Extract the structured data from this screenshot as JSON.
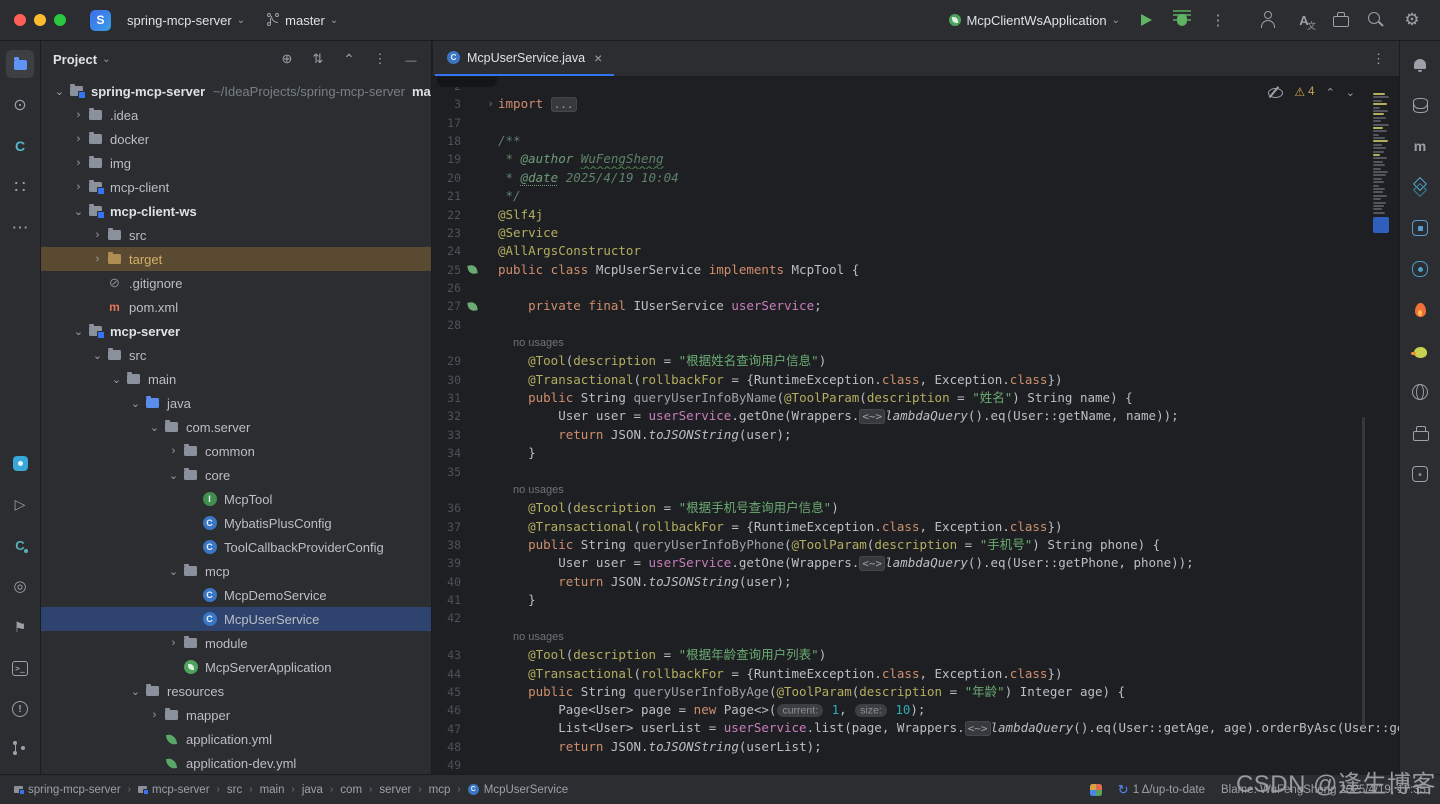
{
  "colors": {
    "accent": "#3574f0",
    "selection": "#2e436e",
    "modified_row": "#5a4a32",
    "warning": "#d9a343",
    "editor_bg": "#1e1f22",
    "panel_bg": "#2b2d30"
  },
  "titlebar": {
    "logo_letter": "S",
    "project_name": "spring-mcp-server",
    "branch_name": "master",
    "run_config": "McpClientWsApplication",
    "actions": [
      "run",
      "debug",
      "more-actions"
    ],
    "tools": [
      "add-user",
      "translate",
      "toolbox",
      "search",
      "settings"
    ]
  },
  "left_toolbar": {
    "top": [
      "project",
      "commit",
      "codegeex",
      "services",
      "more"
    ],
    "bottom": [
      "plugin",
      "run",
      "codegeex-chat",
      "coverage",
      "bookmarks",
      "terminal",
      "problems",
      "version-control"
    ]
  },
  "right_toolbar": [
    "notifications",
    "database",
    "maven",
    "dependencies",
    "plugin-a",
    "plugin-b",
    "hot-reload",
    "duck",
    "translation",
    "printer",
    "ai-assistant"
  ],
  "project_panel": {
    "title": "Project",
    "header_icons": [
      "locate-file",
      "expand-all",
      "collapse-all",
      "more-options",
      "hide-panel"
    ],
    "tree": [
      {
        "label": "spring-mcp-server",
        "suffix": "~/IdeaProjects/spring-mcp-server",
        "branch": "master",
        "level": 0,
        "chevron": "open",
        "icon": "module",
        "bold": true
      },
      {
        "label": ".idea",
        "level": 1,
        "chevron": "closed",
        "icon": "folder"
      },
      {
        "label": "docker",
        "level": 1,
        "chevron": "closed",
        "icon": "folder"
      },
      {
        "label": "img",
        "level": 1,
        "chevron": "closed",
        "icon": "folder"
      },
      {
        "label": "mcp-client",
        "level": 1,
        "chevron": "closed",
        "icon": "module"
      },
      {
        "label": "mcp-client-ws",
        "level": 1,
        "chevron": "open",
        "icon": "module",
        "bold": true
      },
      {
        "label": "src",
        "level": 2,
        "chevron": "closed",
        "icon": "folder"
      },
      {
        "label": "target",
        "level": 2,
        "chevron": "closed",
        "icon": "folder-excluded",
        "state": "modified"
      },
      {
        "label": ".gitignore",
        "level": 2,
        "chevron": "none",
        "icon": "ignored"
      },
      {
        "label": "pom.xml",
        "level": 2,
        "chevron": "none",
        "icon": "maven"
      },
      {
        "label": "mcp-server",
        "level": 1,
        "chevron": "open",
        "icon": "module",
        "bold": true
      },
      {
        "label": "src",
        "level": 2,
        "chevron": "open",
        "icon": "folder"
      },
      {
        "label": "main",
        "level": 3,
        "chevron": "open",
        "icon": "folder"
      },
      {
        "label": "java",
        "level": 4,
        "chevron": "open",
        "icon": "folder-java"
      },
      {
        "label": "com.server",
        "level": 5,
        "chevron": "open",
        "icon": "folder"
      },
      {
        "label": "common",
        "level": 6,
        "chevron": "closed",
        "icon": "folder"
      },
      {
        "label": "core",
        "level": 6,
        "chevron": "open",
        "icon": "folder"
      },
      {
        "label": "McpTool",
        "level": 7,
        "chevron": "none",
        "icon": "interface"
      },
      {
        "label": "MybatisPlusConfig",
        "level": 7,
        "chevron": "none",
        "icon": "class"
      },
      {
        "label": "ToolCallbackProviderConfig",
        "level": 7,
        "chevron": "none",
        "icon": "class"
      },
      {
        "label": "mcp",
        "level": 6,
        "chevron": "open",
        "icon": "folder"
      },
      {
        "label": "McpDemoService",
        "level": 7,
        "chevron": "none",
        "icon": "class"
      },
      {
        "label": "McpUserService",
        "level": 7,
        "chevron": "none",
        "icon": "class",
        "state": "selected"
      },
      {
        "label": "module",
        "level": 6,
        "chevron": "closed",
        "icon": "folder"
      },
      {
        "label": "McpServerApplication",
        "level": 6,
        "chevron": "none",
        "icon": "spring-boot"
      },
      {
        "label": "resources",
        "level": 4,
        "chevron": "open",
        "icon": "folder"
      },
      {
        "label": "mapper",
        "level": 5,
        "chevron": "closed",
        "icon": "folder"
      },
      {
        "label": "application.yml",
        "level": 5,
        "chevron": "none",
        "icon": "leaf"
      },
      {
        "label": "application-dev.yml",
        "level": 5,
        "chevron": "none",
        "icon": "leaf"
      }
    ]
  },
  "editor": {
    "tab": {
      "label": "McpUserService.java"
    },
    "inspections": {
      "warning_count": "4"
    },
    "code": [
      {
        "n": "2",
        "segs": []
      },
      {
        "n": "3",
        "fold": "closed",
        "segs": [
          {
            "t": "import ",
            "c": "k"
          },
          {
            "t": "...",
            "c": "fold"
          }
        ]
      },
      {
        "n": "17",
        "segs": []
      },
      {
        "n": "18",
        "segs": [
          {
            "t": "/**",
            "c": "d"
          }
        ]
      },
      {
        "n": "19",
        "segs": [
          {
            "t": " * ",
            "c": "d"
          },
          {
            "t": "@author",
            "c": "dt"
          },
          {
            "t": " ",
            "c": "d"
          },
          {
            "t": "WuFengSheng",
            "c": "dsp"
          }
        ]
      },
      {
        "n": "20",
        "segs": [
          {
            "t": " * ",
            "c": "d"
          },
          {
            "t": "@date",
            "c": "dtsp"
          },
          {
            "t": " 2025/4/19 10:04",
            "c": "d"
          }
        ]
      },
      {
        "n": "21",
        "segs": [
          {
            "t": " */",
            "c": "d"
          }
        ]
      },
      {
        "n": "22",
        "segs": [
          {
            "t": "@Slf4j",
            "c": "a"
          }
        ]
      },
      {
        "n": "23",
        "segs": [
          {
            "t": "@Service",
            "c": "a"
          }
        ]
      },
      {
        "n": "24",
        "segs": [
          {
            "t": "@AllArgsConstructor",
            "c": "a"
          }
        ]
      },
      {
        "n": "25",
        "gutter": "bean",
        "segs": [
          {
            "t": "public class ",
            "c": "k"
          },
          {
            "t": "McpUserService ",
            "c": "p"
          },
          {
            "t": "implements ",
            "c": "k"
          },
          {
            "t": "McpTool {",
            "c": "p"
          }
        ]
      },
      {
        "n": "26",
        "segs": []
      },
      {
        "n": "27",
        "gutter": "bean",
        "segs": [
          {
            "t": "    ",
            "c": "p"
          },
          {
            "t": "private final ",
            "c": "k"
          },
          {
            "t": "IUserService ",
            "c": "p"
          },
          {
            "t": "userService",
            "c": "f"
          },
          {
            "t": ";",
            "c": "p"
          }
        ]
      },
      {
        "n": "28",
        "segs": []
      },
      {
        "inlay": "no usages"
      },
      {
        "n": "29",
        "segs": [
          {
            "t": "    ",
            "c": "p"
          },
          {
            "t": "@Tool",
            "c": "a"
          },
          {
            "t": "(",
            "c": "p"
          },
          {
            "t": "description",
            "c": "a"
          },
          {
            "t": " = ",
            "c": "p"
          },
          {
            "t": "\"根据姓名查询用户信息\"",
            "c": "s"
          },
          {
            "t": ")",
            "c": "p"
          }
        ]
      },
      {
        "n": "30",
        "segs": [
          {
            "t": "    ",
            "c": "p"
          },
          {
            "t": "@Transactional",
            "c": "a"
          },
          {
            "t": "(",
            "c": "p"
          },
          {
            "t": "rollbackFor",
            "c": "a"
          },
          {
            "t": " = {RuntimeException.",
            "c": "p"
          },
          {
            "t": "class",
            "c": "k"
          },
          {
            "t": ", Exception.",
            "c": "p"
          },
          {
            "t": "class",
            "c": "k"
          },
          {
            "t": "})",
            "c": "p"
          }
        ]
      },
      {
        "n": "31",
        "segs": [
          {
            "t": "    ",
            "c": "p"
          },
          {
            "t": "public ",
            "c": "k"
          },
          {
            "t": "String ",
            "c": "p"
          },
          {
            "t": "queryUserInfoByName",
            "c": "m"
          },
          {
            "t": "(",
            "c": "p"
          },
          {
            "t": "@ToolParam",
            "c": "a"
          },
          {
            "t": "(",
            "c": "p"
          },
          {
            "t": "description",
            "c": "a"
          },
          {
            "t": " = ",
            "c": "p"
          },
          {
            "t": "\"姓名\"",
            "c": "s"
          },
          {
            "t": ") String name) {",
            "c": "p"
          }
        ]
      },
      {
        "n": "32",
        "segs": [
          {
            "t": "        User user = ",
            "c": "p"
          },
          {
            "t": "userService",
            "c": "f"
          },
          {
            "t": ".getOne(Wrappers.",
            "c": "p"
          },
          {
            "t": "<~>",
            "c": "fold"
          },
          {
            "t": "lambdaQuery",
            "c": "i"
          },
          {
            "t": "().eq(User::getName, name));",
            "c": "p"
          }
        ]
      },
      {
        "n": "33",
        "segs": [
          {
            "t": "        ",
            "c": "p"
          },
          {
            "t": "return ",
            "c": "k"
          },
          {
            "t": "JSON.",
            "c": "p"
          },
          {
            "t": "toJSONString",
            "c": "i"
          },
          {
            "t": "(user);",
            "c": "p"
          }
        ]
      },
      {
        "n": "34",
        "segs": [
          {
            "t": "    }",
            "c": "p"
          }
        ]
      },
      {
        "n": "35",
        "segs": []
      },
      {
        "inlay": "no usages"
      },
      {
        "n": "36",
        "segs": [
          {
            "t": "    ",
            "c": "p"
          },
          {
            "t": "@Tool",
            "c": "a"
          },
          {
            "t": "(",
            "c": "p"
          },
          {
            "t": "description",
            "c": "a"
          },
          {
            "t": " = ",
            "c": "p"
          },
          {
            "t": "\"根据手机号查询用户信息\"",
            "c": "s"
          },
          {
            "t": ")",
            "c": "p"
          }
        ]
      },
      {
        "n": "37",
        "segs": [
          {
            "t": "    ",
            "c": "p"
          },
          {
            "t": "@Transactional",
            "c": "a"
          },
          {
            "t": "(",
            "c": "p"
          },
          {
            "t": "rollbackFor",
            "c": "a"
          },
          {
            "t": " = {RuntimeException.",
            "c": "p"
          },
          {
            "t": "class",
            "c": "k"
          },
          {
            "t": ", Exception.",
            "c": "p"
          },
          {
            "t": "class",
            "c": "k"
          },
          {
            "t": "})",
            "c": "p"
          }
        ]
      },
      {
        "n": "38",
        "segs": [
          {
            "t": "    ",
            "c": "p"
          },
          {
            "t": "public ",
            "c": "k"
          },
          {
            "t": "String ",
            "c": "p"
          },
          {
            "t": "queryUserInfoByPhone",
            "c": "m"
          },
          {
            "t": "(",
            "c": "p"
          },
          {
            "t": "@ToolParam",
            "c": "a"
          },
          {
            "t": "(",
            "c": "p"
          },
          {
            "t": "description",
            "c": "a"
          },
          {
            "t": " = ",
            "c": "p"
          },
          {
            "t": "\"手机号\"",
            "c": "s"
          },
          {
            "t": ") String phone) {",
            "c": "p"
          }
        ]
      },
      {
        "n": "39",
        "segs": [
          {
            "t": "        User user = ",
            "c": "p"
          },
          {
            "t": "userService",
            "c": "f"
          },
          {
            "t": ".getOne(Wrappers.",
            "c": "p"
          },
          {
            "t": "<~>",
            "c": "fold"
          },
          {
            "t": "lambdaQuery",
            "c": "i"
          },
          {
            "t": "().eq(User::getPhone, phone));",
            "c": "p"
          }
        ]
      },
      {
        "n": "40",
        "segs": [
          {
            "t": "        ",
            "c": "p"
          },
          {
            "t": "return ",
            "c": "k"
          },
          {
            "t": "JSON.",
            "c": "p"
          },
          {
            "t": "toJSONString",
            "c": "i"
          },
          {
            "t": "(user);",
            "c": "p"
          }
        ]
      },
      {
        "n": "41",
        "segs": [
          {
            "t": "    }",
            "c": "p"
          }
        ]
      },
      {
        "n": "42",
        "segs": []
      },
      {
        "inlay": "no usages"
      },
      {
        "n": "43",
        "segs": [
          {
            "t": "    ",
            "c": "p"
          },
          {
            "t": "@Tool",
            "c": "a"
          },
          {
            "t": "(",
            "c": "p"
          },
          {
            "t": "description",
            "c": "a"
          },
          {
            "t": " = ",
            "c": "p"
          },
          {
            "t": "\"根据年龄查询用户列表\"",
            "c": "s"
          },
          {
            "t": ")",
            "c": "p"
          }
        ]
      },
      {
        "n": "44",
        "segs": [
          {
            "t": "    ",
            "c": "p"
          },
          {
            "t": "@Transactional",
            "c": "a"
          },
          {
            "t": "(",
            "c": "p"
          },
          {
            "t": "rollbackFor",
            "c": "a"
          },
          {
            "t": " = {RuntimeException.",
            "c": "p"
          },
          {
            "t": "class",
            "c": "k"
          },
          {
            "t": ", Exception.",
            "c": "p"
          },
          {
            "t": "class",
            "c": "k"
          },
          {
            "t": "})",
            "c": "p"
          }
        ]
      },
      {
        "n": "45",
        "segs": [
          {
            "t": "    ",
            "c": "p"
          },
          {
            "t": "public ",
            "c": "k"
          },
          {
            "t": "String ",
            "c": "p"
          },
          {
            "t": "queryUserInfoByAge",
            "c": "m"
          },
          {
            "t": "(",
            "c": "p"
          },
          {
            "t": "@ToolParam",
            "c": "a"
          },
          {
            "t": "(",
            "c": "p"
          },
          {
            "t": "description",
            "c": "a"
          },
          {
            "t": " = ",
            "c": "p"
          },
          {
            "t": "\"年龄\"",
            "c": "s"
          },
          {
            "t": ") Integer age) {",
            "c": "p"
          }
        ]
      },
      {
        "n": "46",
        "segs": [
          {
            "t": "        Page<User> page = ",
            "c": "p"
          },
          {
            "t": "new ",
            "c": "k"
          },
          {
            "t": "Page<>(",
            "c": "p"
          },
          {
            "t": "current:",
            "c": "h"
          },
          {
            "t": " ",
            "c": "p"
          },
          {
            "t": "1",
            "c": "n"
          },
          {
            "t": ", ",
            "c": "p"
          },
          {
            "t": "size:",
            "c": "h"
          },
          {
            "t": " ",
            "c": "p"
          },
          {
            "t": "10",
            "c": "n"
          },
          {
            "t": ");",
            "c": "p"
          }
        ]
      },
      {
        "n": "47",
        "segs": [
          {
            "t": "        List<User> userList = ",
            "c": "p"
          },
          {
            "t": "userService",
            "c": "f"
          },
          {
            "t": ".list(page, Wrappers.",
            "c": "p"
          },
          {
            "t": "<~>",
            "c": "fold"
          },
          {
            "t": "lambdaQuery",
            "c": "i"
          },
          {
            "t": "().eq(User::getAge, age).orderByAsc(User::getName));",
            "c": "p"
          }
        ]
      },
      {
        "n": "48",
        "segs": [
          {
            "t": "        ",
            "c": "p"
          },
          {
            "t": "return ",
            "c": "k"
          },
          {
            "t": "JSON.",
            "c": "p"
          },
          {
            "t": "toJSONString",
            "c": "i"
          },
          {
            "t": "(userList);",
            "c": "p"
          }
        ]
      },
      {
        "n": "49",
        "segs": []
      }
    ]
  },
  "status_bar": {
    "breadcrumbs": [
      {
        "label": "spring-mcp-server",
        "icon": "module"
      },
      {
        "label": "mcp-server",
        "icon": "module"
      },
      {
        "label": "src"
      },
      {
        "label": "main"
      },
      {
        "label": "java"
      },
      {
        "label": "com"
      },
      {
        "label": "server"
      },
      {
        "label": "mcp"
      },
      {
        "label": "McpUserService",
        "icon": "class"
      }
    ],
    "vcs": "1 Δ/up-to-date",
    "blame": "Blame: WuFengSheng 2025/4/19, 17:35"
  },
  "watermark": "CSDN @逢生博客"
}
